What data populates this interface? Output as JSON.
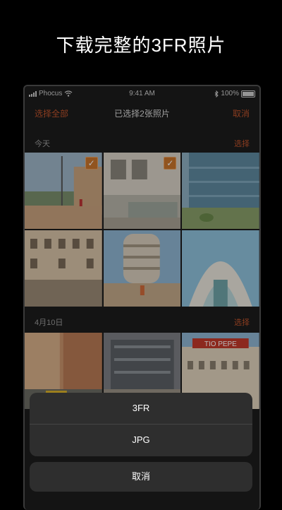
{
  "headline": "下载完整的3FR照片",
  "status_bar": {
    "carrier": "Phocus",
    "time": "9:41 AM",
    "battery": "100%"
  },
  "nav": {
    "select_all": "选择全部",
    "title": "已选择2张照片",
    "cancel": "取消"
  },
  "sections": [
    {
      "label": "今天",
      "action": "选择"
    },
    {
      "label": "4月10日",
      "action": "选择"
    }
  ],
  "photos": {
    "today": [
      {
        "selected": true
      },
      {
        "selected": true
      },
      {
        "selected": false
      },
      {
        "selected": false
      },
      {
        "selected": false
      },
      {
        "selected": false
      }
    ],
    "apr10": [
      {
        "selected": false
      },
      {
        "selected": false
      },
      {
        "selected": false
      }
    ]
  },
  "sign_text": {
    "tio_pepe": "TIO PEPE"
  },
  "action_sheet": {
    "options": [
      "3FR",
      "JPG"
    ],
    "cancel": "取消"
  },
  "colors": {
    "accent": "#c0542c",
    "checkbox": "#c9752c",
    "sheet_bg": "#2e2e2e"
  }
}
